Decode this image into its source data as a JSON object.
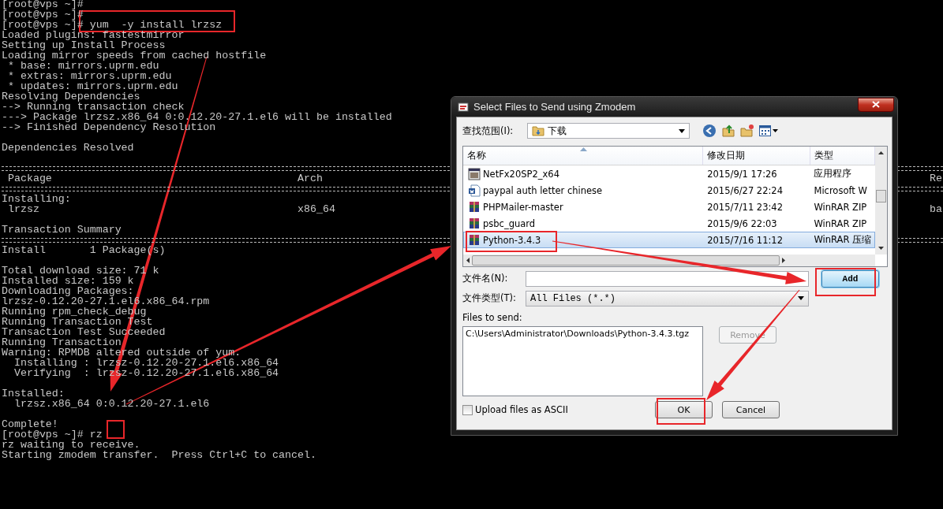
{
  "terminal": {
    "lines": [
      {
        "kind": "text",
        "text": "[root@vps ~]#"
      },
      {
        "kind": "text",
        "text": "[root@vps ~]#"
      },
      {
        "kind": "text",
        "text": "[root@vps ~]# yum  -y install lrzsz"
      },
      {
        "kind": "text",
        "text": "Loaded plugins: fastestmirror"
      },
      {
        "kind": "text",
        "text": "Setting up Install Process"
      },
      {
        "kind": "text",
        "text": "Loading mirror speeds from cached hostfile"
      },
      {
        "kind": "text",
        "text": " * base: mirrors.uprm.edu"
      },
      {
        "kind": "text",
        "text": " * extras: mirrors.uprm.edu"
      },
      {
        "kind": "text",
        "text": " * updates: mirrors.uprm.edu"
      },
      {
        "kind": "text",
        "text": "Resolving Dependencies"
      },
      {
        "kind": "text",
        "text": "--> Running transaction check"
      },
      {
        "kind": "text",
        "text": "---> Package lrzsz.x86_64 0:0.12.20-27.1.el6 will be installed"
      },
      {
        "kind": "text",
        "text": "--> Finished Dependency Resolution"
      },
      {
        "kind": "blank"
      },
      {
        "kind": "text",
        "text": "Dependencies Resolved"
      },
      {
        "kind": "blank"
      },
      {
        "kind": "rule"
      },
      {
        "kind": "text",
        "text": " Package                                       Arch",
        "tail": "Re"
      },
      {
        "kind": "rule"
      },
      {
        "kind": "text",
        "text": "Installing:"
      },
      {
        "kind": "text",
        "text": " lrzsz                                         x86_64",
        "tail": "ba"
      },
      {
        "kind": "blank"
      },
      {
        "kind": "text",
        "text": "Transaction Summary"
      },
      {
        "kind": "rule"
      },
      {
        "kind": "text",
        "text": "Install       1 Package(s)"
      },
      {
        "kind": "blank"
      },
      {
        "kind": "text",
        "text": "Total download size: 71 k"
      },
      {
        "kind": "text",
        "text": "Installed size: 159 k"
      },
      {
        "kind": "text",
        "text": "Downloading Packages:"
      },
      {
        "kind": "text",
        "text": "lrzsz-0.12.20-27.1.el6.x86_64.rpm"
      },
      {
        "kind": "text",
        "text": "Running rpm_check_debug"
      },
      {
        "kind": "text",
        "text": "Running Transaction Test"
      },
      {
        "kind": "text",
        "text": "Transaction Test Succeeded"
      },
      {
        "kind": "text",
        "text": "Running Transaction"
      },
      {
        "kind": "text",
        "text": "Warning: RPMDB altered outside of yum."
      },
      {
        "kind": "text",
        "text": "  Installing : lrzsz-0.12.20-27.1.el6.x86_64"
      },
      {
        "kind": "text",
        "text": "  Verifying  : lrzsz-0.12.20-27.1.el6.x86_64"
      },
      {
        "kind": "blank"
      },
      {
        "kind": "text",
        "text": "Installed:"
      },
      {
        "kind": "text",
        "text": "  lrzsz.x86_64 0:0.12.20-27.1.el6"
      },
      {
        "kind": "blank"
      },
      {
        "kind": "text",
        "text": "Complete!"
      },
      {
        "kind": "text",
        "text": "[root@vps ~]# rz"
      },
      {
        "kind": "text",
        "text": "rz waiting to receive."
      },
      {
        "kind": "text",
        "text": "Starting zmodem transfer.  Press Ctrl+C to cancel."
      }
    ]
  },
  "dialog": {
    "title": "Select Files to Send using Zmodem",
    "look_in": {
      "label": "查找范围(I):",
      "value": "下载"
    },
    "columns": [
      "名称",
      "修改日期",
      "类型"
    ],
    "files": [
      {
        "kind": "exe",
        "name": "NetFx20SP2_x64",
        "date": "2015/9/1 17:26",
        "type": "应用程序",
        "selected": false
      },
      {
        "kind": "doc",
        "name": "paypal auth letter chinese",
        "date": "2015/6/27 22:24",
        "type": "Microsoft W",
        "selected": false
      },
      {
        "kind": "rar",
        "name": "PHPMailer-master",
        "date": "2015/7/11 23:42",
        "type": "WinRAR ZIP",
        "selected": false
      },
      {
        "kind": "rar",
        "name": "psbc_guard",
        "date": "2015/9/6 22:03",
        "type": "WinRAR ZIP",
        "selected": false
      },
      {
        "kind": "rar",
        "name": "Python-3.4.3",
        "date": "2015/7/16 11:12",
        "type": "WinRAR 压缩",
        "selected": true
      }
    ],
    "file_name": {
      "label": "文件名(N):"
    },
    "file_type": {
      "label": "文件类型(T):",
      "value": "All Files (*.*)"
    },
    "files_to_send": {
      "label": "Files to send:",
      "items": [
        "C:\\Users\\Administrator\\Downloads\\Python-3.4.3.tgz"
      ]
    },
    "add_button": {
      "label": "Add",
      "focused": true,
      "disabled": false
    },
    "remove_button": {
      "label": "Remove",
      "focused": false,
      "disabled": true
    },
    "ascii": {
      "label": "Upload files as ASCII",
      "checked": false
    },
    "ok_button": {
      "label": "OK",
      "focused": false,
      "disabled": false
    },
    "cancel_button": {
      "label": "Cancel",
      "focused": false,
      "disabled": false
    }
  }
}
